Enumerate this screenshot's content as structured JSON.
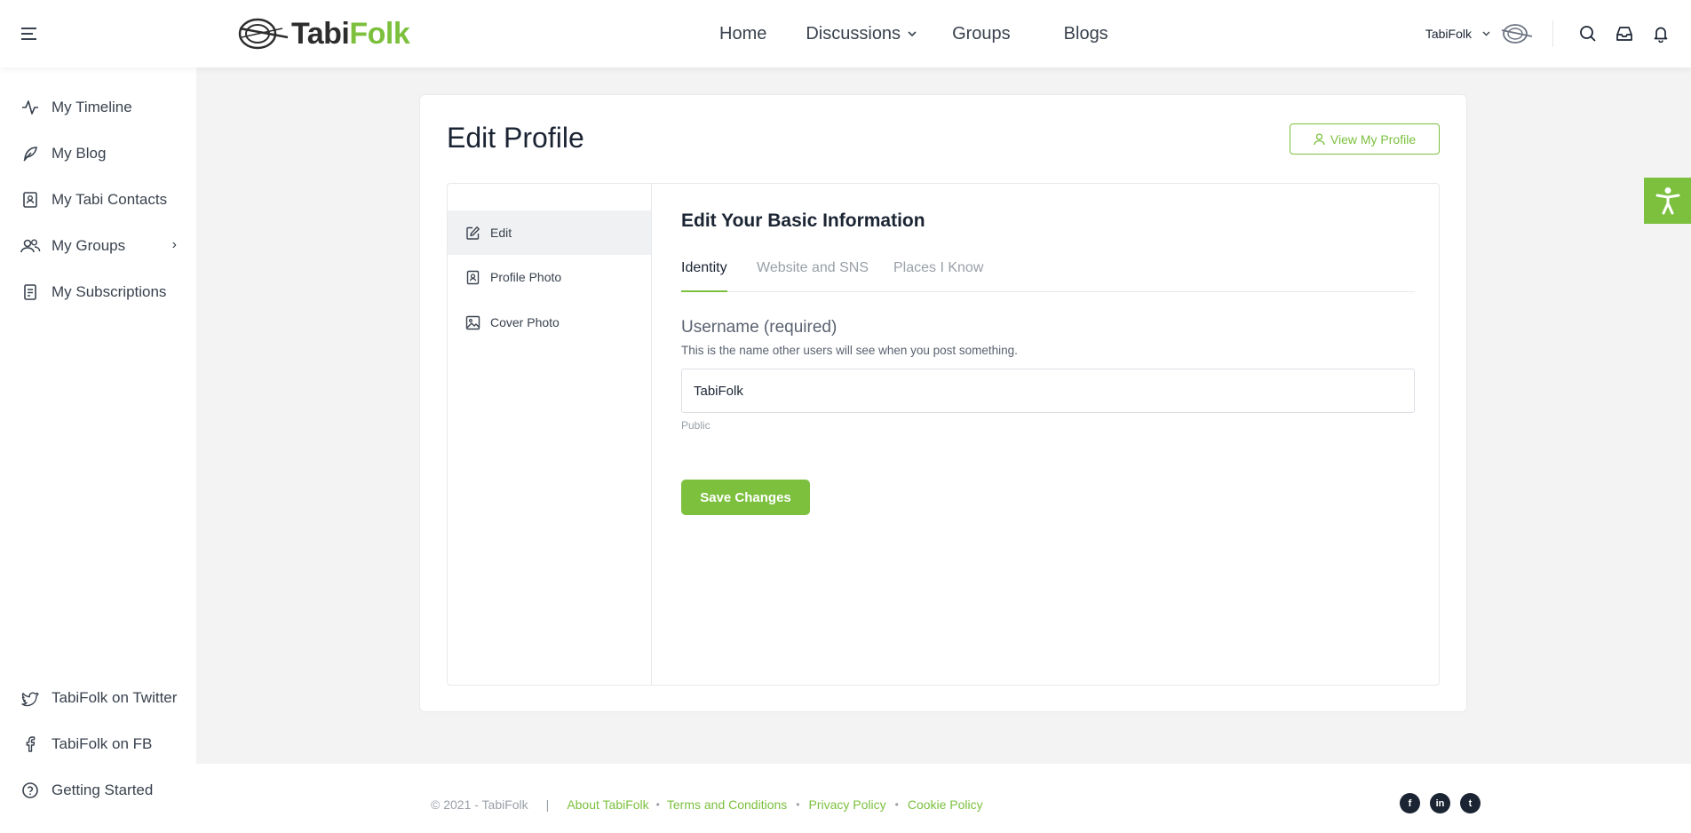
{
  "header": {
    "logo": {
      "part1": "Tabi",
      "part2": "Folk"
    },
    "nav": [
      {
        "label": "Home"
      },
      {
        "label": "Discussions"
      },
      {
        "label": "Groups"
      },
      {
        "label": "Blogs"
      }
    ],
    "user_name": "TabiFolk"
  },
  "sidebar": {
    "items": [
      {
        "label": "My Timeline",
        "icon": "activity-icon"
      },
      {
        "label": "My Blog",
        "icon": "feather-icon"
      },
      {
        "label": "My Tabi Contacts",
        "icon": "contact-book-icon"
      },
      {
        "label": "My Groups",
        "icon": "users-icon"
      },
      {
        "label": "My Subscriptions",
        "icon": "subscriptions-icon"
      }
    ],
    "bottom_items": [
      {
        "label": "TabiFolk on Twitter",
        "icon": "twitter-icon"
      },
      {
        "label": "TabiFolk on FB",
        "icon": "facebook-icon"
      },
      {
        "label": "Getting Started",
        "icon": "help-circle-icon"
      }
    ]
  },
  "main": {
    "title": "Edit Profile",
    "view_profile_label": "View My Profile",
    "subnav": [
      {
        "label": "Edit",
        "active": true
      },
      {
        "label": "Profile Photo",
        "active": false
      },
      {
        "label": "Cover Photo",
        "active": false
      }
    ],
    "section_title": "Edit Your Basic Information",
    "tabs": [
      {
        "label": "Identity",
        "active": true
      },
      {
        "label": "Website and SNS",
        "active": false
      },
      {
        "label": "Places I Know",
        "active": false
      }
    ],
    "field": {
      "label": "Username (required)",
      "help": "This is the name other users will see when you post something.",
      "value": "TabiFolk",
      "visibility": "Public"
    },
    "save_label": "Save Changes"
  },
  "footer": {
    "copyright": "© 2021 - TabiFolk",
    "separator": "|",
    "links": [
      {
        "label": "About TabiFolk"
      },
      {
        "label": "Terms and Conditions"
      },
      {
        "label": "Privacy Policy"
      },
      {
        "label": "Cookie Policy"
      }
    ],
    "socials": [
      {
        "icon": "facebook-icon",
        "glyph": "f"
      },
      {
        "icon": "linkedin-icon",
        "glyph": "in"
      },
      {
        "icon": "twitter-icon",
        "glyph": "t"
      }
    ]
  },
  "colors": {
    "accent": "#7cc03e",
    "text": "#1b2433",
    "muted": "#9aa0a8",
    "background": "#f3f3f4"
  }
}
